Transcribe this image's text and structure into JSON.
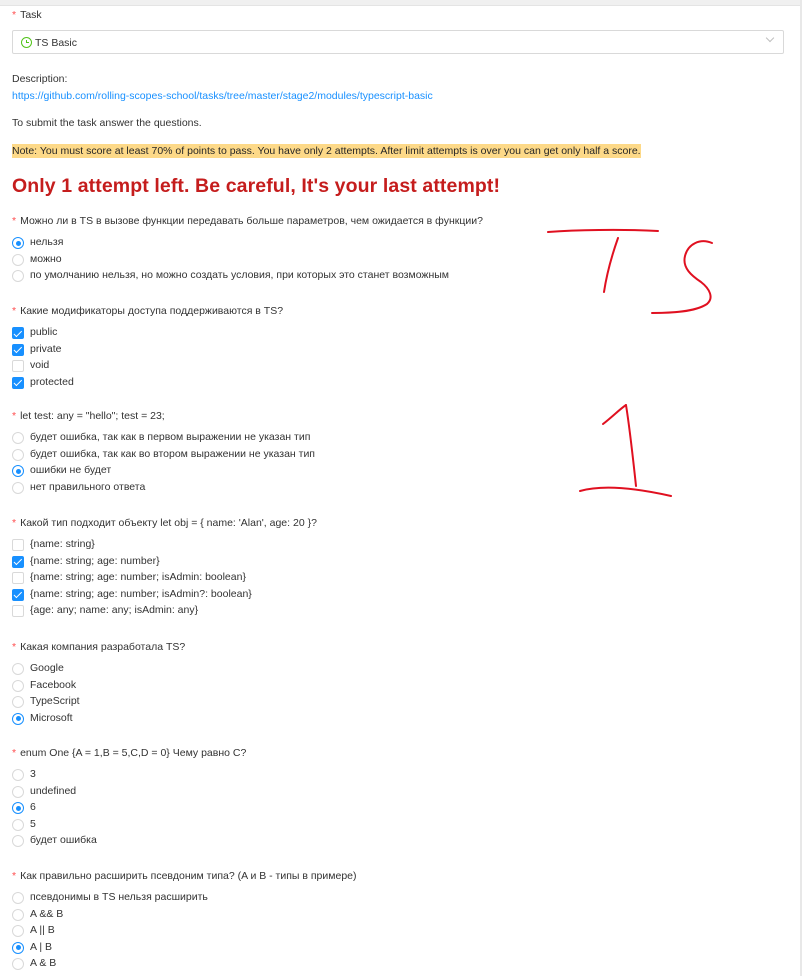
{
  "colors": {
    "accent": "#1890ff",
    "warning_text": "#c51d1d",
    "note_bg": "#fdd988",
    "required": "#ff4d4f",
    "ink": "#e01020"
  },
  "form": {
    "task_label": "Task",
    "task_select_value": "TS Basic",
    "task_icon": "clock-icon",
    "description_label": "Description:",
    "description_link": "https://github.com/rolling-scopes-school/tasks/tree/master/stage2/modules/typescript-basic",
    "instructions": "To submit the task answer the questions.",
    "note": "Note: You must score at least 70% of points to pass. You have only 2 attempts. After limit attempts is over you can get only half a score.",
    "attempts_warning": "Only 1 attempt left. Be careful, It's your last attempt!"
  },
  "annotations": {
    "drawn_text_1": "TS",
    "drawn_text_2": "1"
  },
  "questions": [
    {
      "text": "Можно ли в TS в вызове функции передавать больше параметров, чем ожидается в функции?",
      "type": "radio",
      "options": [
        {
          "label": "нельзя",
          "checked": true
        },
        {
          "label": "можно",
          "checked": false
        },
        {
          "label": "по умолчанию нельзя, но можно создать условия, при которых это станет возможным",
          "checked": false
        }
      ]
    },
    {
      "text": "Какие модификаторы доступа поддерживаются в TS?",
      "type": "checkbox",
      "options": [
        {
          "label": "public",
          "checked": true
        },
        {
          "label": "private",
          "checked": true
        },
        {
          "label": "void",
          "checked": false
        },
        {
          "label": "protected",
          "checked": true
        }
      ]
    },
    {
      "text": "let test: any = \"hello\"; test = 23;",
      "type": "radio",
      "options": [
        {
          "label": "будет ошибка, так как в первом выражении не указан тип",
          "checked": false
        },
        {
          "label": "будет ошибка, так как во втором выражении не указан тип",
          "checked": false
        },
        {
          "label": "ошибки не будет",
          "checked": true
        },
        {
          "label": "нет правильного ответа",
          "checked": false
        }
      ]
    },
    {
      "text": "Какой тип подходит объекту let obj = { name: 'Alan', age: 20 }?",
      "type": "checkbox",
      "options": [
        {
          "label": "{name: string}",
          "checked": false
        },
        {
          "label": "{name: string; age: number}",
          "checked": true
        },
        {
          "label": "{name: string; age: number; isAdmin: boolean}",
          "checked": false
        },
        {
          "label": "{name: string; age: number; isAdmin?: boolean}",
          "checked": true
        },
        {
          "label": "{age: any; name: any; isAdmin: any}",
          "checked": false
        }
      ]
    },
    {
      "text": "Какая компания разработала TS?",
      "type": "radio",
      "options": [
        {
          "label": "Google",
          "checked": false
        },
        {
          "label": "Facebook",
          "checked": false
        },
        {
          "label": "TypeScript",
          "checked": false
        },
        {
          "label": "Microsoft",
          "checked": true
        }
      ]
    },
    {
      "text": "enum One {A = 1,B = 5,C,D = 0} Чему равно C?",
      "type": "radio",
      "options": [
        {
          "label": "3",
          "checked": false
        },
        {
          "label": "undefined",
          "checked": false
        },
        {
          "label": "6",
          "checked": true
        },
        {
          "label": "5",
          "checked": false
        },
        {
          "label": "будет ошибка",
          "checked": false
        }
      ]
    },
    {
      "text": "Как правильно расширить псевдоним типа? (A и B - типы в примере)",
      "type": "radio",
      "options": [
        {
          "label": "псевдонимы в TS нельзя расширить",
          "checked": false
        },
        {
          "label": "A && B",
          "checked": false
        },
        {
          "label": "A || B",
          "checked": false
        },
        {
          "label": "A | B",
          "checked": true
        },
        {
          "label": "A & B",
          "checked": false
        }
      ]
    }
  ]
}
